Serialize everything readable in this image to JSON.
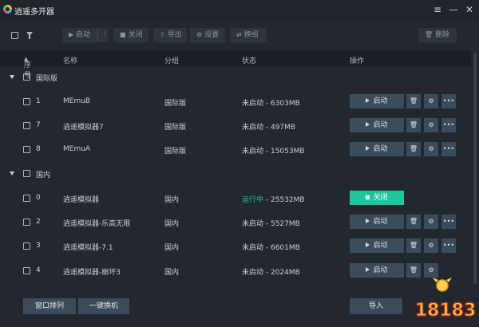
{
  "window": {
    "title": "逍遥多开器",
    "menu_icon": "≡",
    "minimize_icon": "—",
    "close_icon": "✕"
  },
  "toolbar": {
    "start_label": "启动",
    "stop_label": "关闭",
    "export_label": "导出",
    "settings_label": "设置",
    "switch_label": "换组",
    "delete_label": "删除"
  },
  "table": {
    "columns": [
      "序号",
      "名称",
      "分组",
      "状态",
      "操作"
    ],
    "groups": [
      {
        "name": "国际版",
        "rows": [
          {
            "index": "1",
            "name": "MEmuB",
            "group": "国际版",
            "status": "未启动 - 6303MB",
            "action": "启动"
          },
          {
            "index": "7",
            "name": "逍遥模拟器7",
            "group": "国际版",
            "status": "未启动 - 497MB",
            "action": "启动"
          },
          {
            "index": "8",
            "name": "MEmuA",
            "group": "国际版",
            "status": "未启动 - 15053MB",
            "action": "启动"
          }
        ]
      },
      {
        "name": "国内",
        "rows": [
          {
            "index": "0",
            "name": "逍遥模拟器",
            "group": "国内",
            "status_prefix": "运行中",
            "status_suffix": " - 25532MB",
            "action": "关闭"
          },
          {
            "index": "2",
            "name": "逍遥模拟器-乐高无限",
            "group": "国内",
            "status": "未启动 - 5527MB",
            "action": "启动"
          },
          {
            "index": "3",
            "name": "逍遥模拟器-7.1",
            "group": "国内",
            "status": "未启动 - 6601MB",
            "action": "启动"
          },
          {
            "index": "4",
            "name": "逍遥模拟器-崩坏3",
            "group": "国内",
            "status": "未启动 - 2024MB",
            "action": "启动"
          }
        ]
      }
    ]
  },
  "footer": {
    "arrange_label": "窗口排列",
    "one_click_label": "一键换机",
    "import_label": "导入"
  },
  "watermark": {
    "text": "18183"
  },
  "colors": {
    "background": "#23282f",
    "accent_running": "#1ec79b",
    "button": "#3c4b59"
  }
}
